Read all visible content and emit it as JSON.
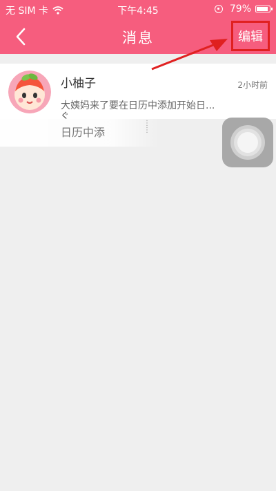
{
  "status_bar": {
    "carrier": "无 SIM 卡",
    "time": "下午4:45",
    "battery": "79%",
    "battery_level": 0.79
  },
  "nav": {
    "title": "消息",
    "edit_label": "编辑",
    "back_icon": "chevron-left-icon"
  },
  "messages": [
    {
      "name": "小柚子",
      "time": "2小时前",
      "preview": "大姨妈来了要在日历中添加开始日..."
    }
  ],
  "ghost": {
    "text": "日历中添",
    "text2": "ぐ"
  },
  "colors": {
    "brand_pink": "#f65d7e",
    "annotation_red": "#e02020",
    "background": "#efefef"
  }
}
